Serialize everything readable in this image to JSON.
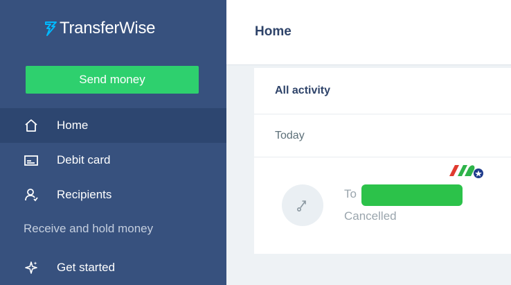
{
  "app": {
    "brand_name": "TransferWise"
  },
  "sidebar": {
    "send_button": "Send money",
    "items": [
      {
        "label": "Home",
        "icon": "home-icon",
        "active": true
      },
      {
        "label": "Debit card",
        "icon": "card-icon",
        "active": false
      },
      {
        "label": "Recipients",
        "icon": "recipients-icon",
        "active": false
      }
    ],
    "section_label": "Receive and hold money",
    "extra_items": [
      {
        "label": "Get started",
        "icon": "sparkle-icon"
      }
    ]
  },
  "header": {
    "title": "Home"
  },
  "activity": {
    "tab_label": "All activity",
    "groups": [
      {
        "date": "Today",
        "transactions": [
          {
            "prefix": "To",
            "recipient": "",
            "status": "Cancelled",
            "icon": "transfer-arrow-icon"
          }
        ]
      }
    ]
  },
  "colors": {
    "sidebar_bg": "#37517e",
    "active_item_bg": "#2d4670",
    "send_button": "#2ed06e",
    "title": "#2e4369",
    "redaction": "#2cc24a"
  }
}
